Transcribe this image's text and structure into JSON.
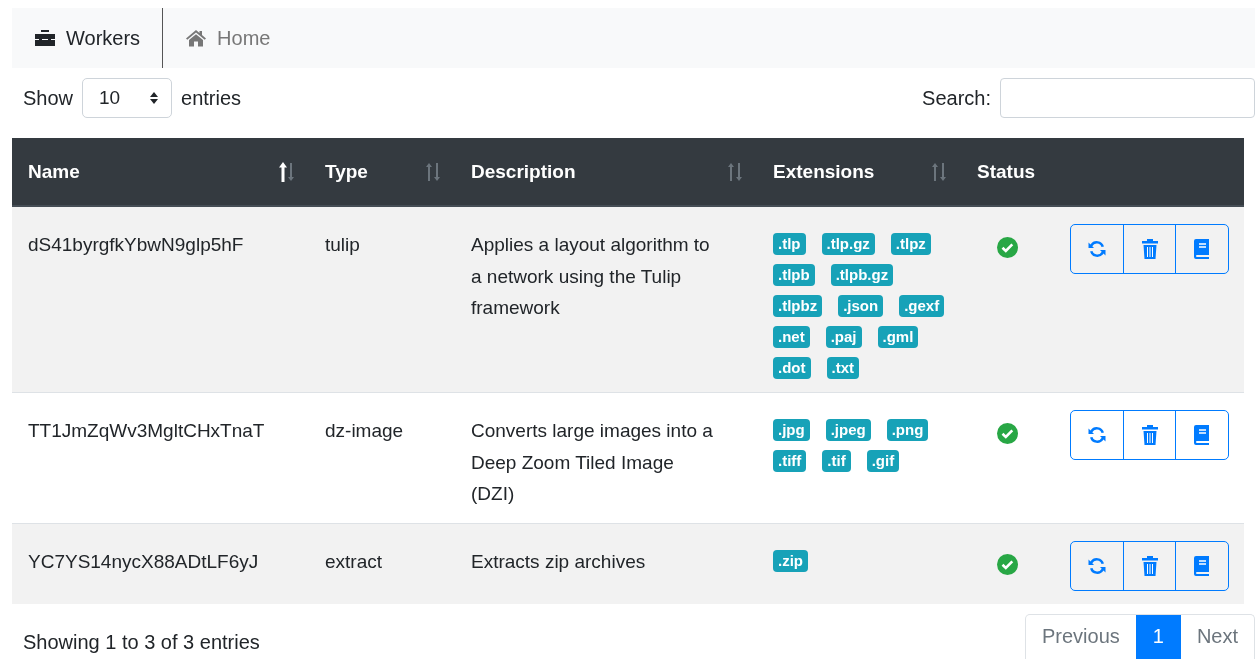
{
  "nav": [
    {
      "label": "Workers",
      "selected": true
    },
    {
      "label": "Home",
      "selected": false
    }
  ],
  "length_control": {
    "prefix": "Show",
    "value": "10",
    "suffix": "entries"
  },
  "search": {
    "label": "Search:"
  },
  "table": {
    "columns": [
      {
        "label": "Name",
        "sortable": true,
        "sorted": true
      },
      {
        "label": "Type",
        "sortable": true,
        "sorted": false
      },
      {
        "label": "Description",
        "sortable": true,
        "sorted": false
      },
      {
        "label": "Extensions",
        "sortable": true,
        "sorted": false
      },
      {
        "label": "Status",
        "sortable": false,
        "sorted": false
      }
    ],
    "rows": [
      {
        "name": "dS41byrgfkYbwN9glp5hF",
        "type": "tulip",
        "description": "Applies a layout algorithm to a network using the Tulip framework",
        "extensions": [
          ".tlp",
          ".tlp.gz",
          ".tlpz",
          ".tlpb",
          ".tlpb.gz",
          ".tlpbz",
          ".json",
          ".gexf",
          ".net",
          ".paj",
          ".gml",
          ".dot",
          ".txt"
        ],
        "active": true
      },
      {
        "name": "TT1JmZqWv3MgltCHxTnaT",
        "type": "dz-image",
        "description": "Converts large images into a Deep Zoom Tiled Image (DZI)",
        "extensions": [
          ".jpg",
          ".jpeg",
          ".png",
          ".tiff",
          ".tif",
          ".gif"
        ],
        "active": true
      },
      {
        "name": "YC7YS14nycX88ADtLF6yJ",
        "type": "extract",
        "description": "Extracts zip archives",
        "extensions": [
          ".zip"
        ],
        "active": true
      }
    ]
  },
  "info": "Showing 1 to 3 of 3 entries",
  "pagination": [
    {
      "label": "Previous",
      "selected": false,
      "disabled": true
    },
    {
      "label": "1",
      "selected": true,
      "disabled": false
    },
    {
      "label": "Next",
      "selected": false,
      "disabled": true
    }
  ]
}
